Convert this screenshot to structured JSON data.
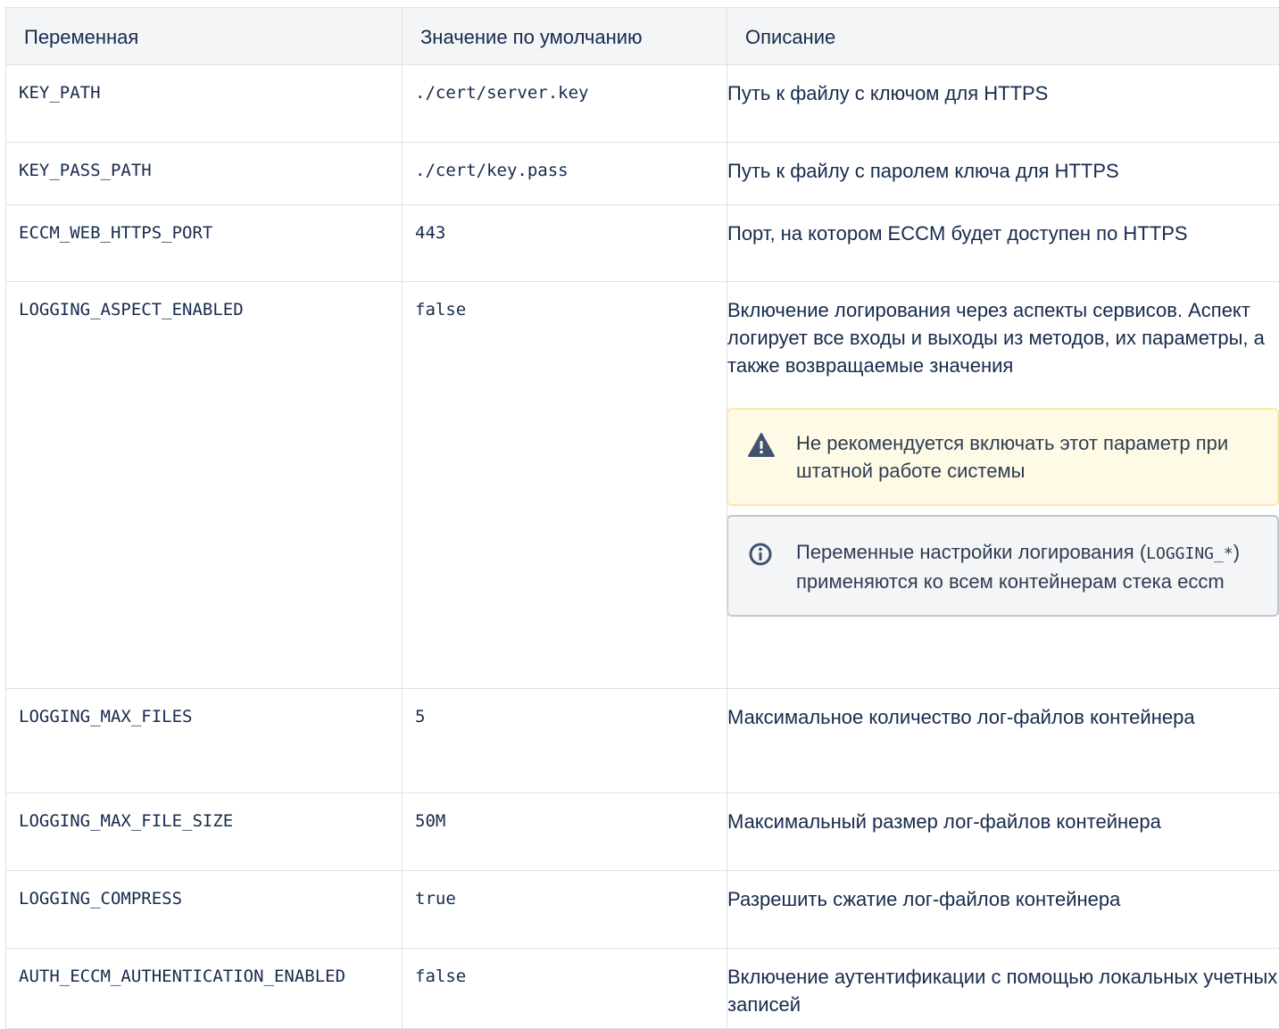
{
  "table": {
    "headers": {
      "variable": "Переменная",
      "default": "Значение по умолчанию",
      "description": "Описание"
    },
    "rows": [
      {
        "variable": "KEY_PATH",
        "default": "./cert/server.key",
        "description": "Путь к файлу с ключом для HTTPS"
      },
      {
        "variable": "KEY_PASS_PATH",
        "default": "./cert/key.pass",
        "description": "Путь к файлу с паролем ключа для HTTPS"
      },
      {
        "variable": "ECCM_WEB_HTTPS_PORT",
        "default": "443",
        "description": "Порт, на котором ECCM будет доступен по HTTPS"
      },
      {
        "variable": "LOGGING_ASPECT_ENABLED",
        "default": "false",
        "description": "Включение логирования через аспекты сервисов. Аспект логирует все входы и выходы из методов, их параметры, а также возвращаемые значения"
      },
      {
        "variable": "LOGGING_MAX_FILES",
        "default": "5",
        "description": "Максимальное количество лог-файлов контейнера"
      },
      {
        "variable": "LOGGING_MAX_FILE_SIZE",
        "default": "50M",
        "description": "Максимальный размер лог-файлов контейнера"
      },
      {
        "variable": "LOGGING_COMPRESS",
        "default": "true",
        "description": "Разрешить сжатие лог-файлов контейнера"
      },
      {
        "variable": "AUTH_ECCM_AUTHENTICATION_ENABLED",
        "default": "false",
        "description": "Включение аутентификации с помощью локальных учетных записей"
      }
    ]
  },
  "warning_panel": {
    "icon": "warning-triangle-icon",
    "text": "Не рекомендуется включать этот параметр при штатной работе системы",
    "color": "#fffae6"
  },
  "info_panel": {
    "icon": "info-circle-icon",
    "text_before": "Переменные настройки логирования (",
    "code": "LOGGING_*",
    "text_after": ") применяются ко всем контейнерам стека eccm",
    "color": "#f4f5f7"
  }
}
